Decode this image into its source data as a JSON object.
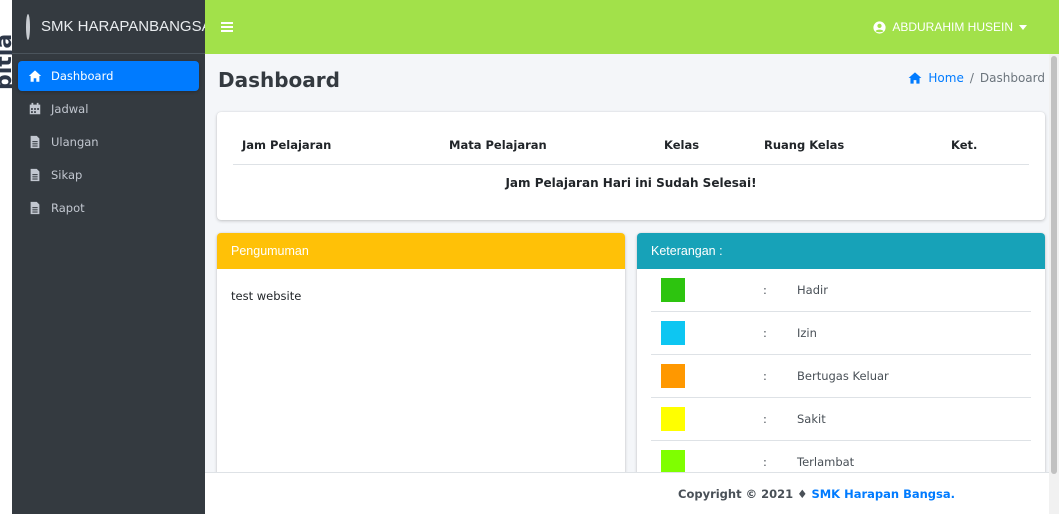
{
  "watermark": {
    "text": "pitja"
  },
  "brand": {
    "name": "SMK HARAPANBANGSA"
  },
  "sidebar": {
    "items": [
      {
        "label": "Dashboard",
        "icon": "home-icon",
        "active": true
      },
      {
        "label": "Jadwal",
        "icon": "calendar-icon",
        "active": false
      },
      {
        "label": "Ulangan",
        "icon": "file-icon",
        "active": false
      },
      {
        "label": "Sikap",
        "icon": "file-icon",
        "active": false
      },
      {
        "label": "Rapot",
        "icon": "file-icon",
        "active": false
      }
    ]
  },
  "topbar": {
    "user_name": "ABDURAHIM HUSEIN"
  },
  "page": {
    "title": "Dashboard",
    "breadcrumb": {
      "home": "Home",
      "separator": "/",
      "current": "Dashboard"
    }
  },
  "schedule": {
    "columns": [
      "Jam Pelajaran",
      "Mata Pelajaran",
      "Kelas",
      "Ruang Kelas",
      "Ket."
    ],
    "message": "Jam Pelajaran Hari ini Sudah Selesai!"
  },
  "announcement": {
    "title": "Pengumuman",
    "body": "test website"
  },
  "legend": {
    "title": "Keterangan :",
    "separator": ":",
    "items": [
      {
        "label": "Hadir",
        "color": "#2dc40f"
      },
      {
        "label": "Izin",
        "color": "#0dc6f2"
      },
      {
        "label": "Bertugas Keluar",
        "color": "#ff9800"
      },
      {
        "label": "Sakit",
        "color": "#ffff00"
      },
      {
        "label": "Terlambat",
        "color": "#7fff00"
      }
    ]
  },
  "footer": {
    "prefix": "Copyright © 2021 ♦",
    "link": "SMK Harapan Bangsa."
  },
  "colors": {
    "topbar": "#a2e14a",
    "sidebar": "#343a40",
    "active": "#007bff",
    "announcement_header": "#ffc107",
    "legend_header": "#17a2b8"
  }
}
